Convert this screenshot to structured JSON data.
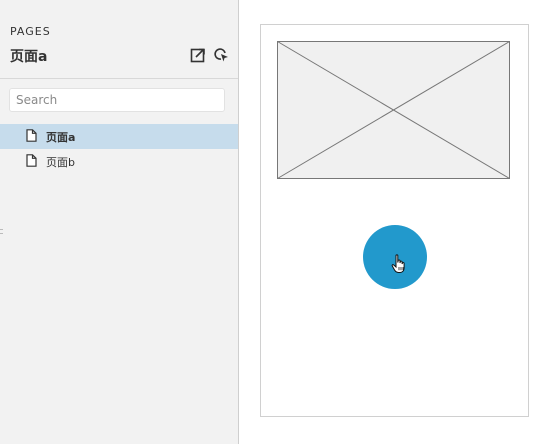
{
  "sidebar": {
    "heading": "PAGES",
    "current_page": "页面a",
    "icons": {
      "export": "export-page-icon",
      "locate": "locate-page-icon"
    },
    "search": {
      "placeholder": "Search",
      "value": ""
    },
    "pages": [
      {
        "label": "页面a",
        "selected": true,
        "icon": "page-document-icon"
      },
      {
        "label": "页面b",
        "selected": false,
        "icon": "page-document-icon"
      }
    ]
  },
  "canvas": {
    "image_placeholder_icon": "image-placeholder-icon",
    "button_icon": "pointer-hand-icon"
  },
  "colors": {
    "sidebar_bg": "#f2f2f2",
    "selected_row": "#c6dcec",
    "accent": "#2299cc",
    "placeholder_fill": "#f0f0f0",
    "placeholder_stroke": "#777777"
  }
}
